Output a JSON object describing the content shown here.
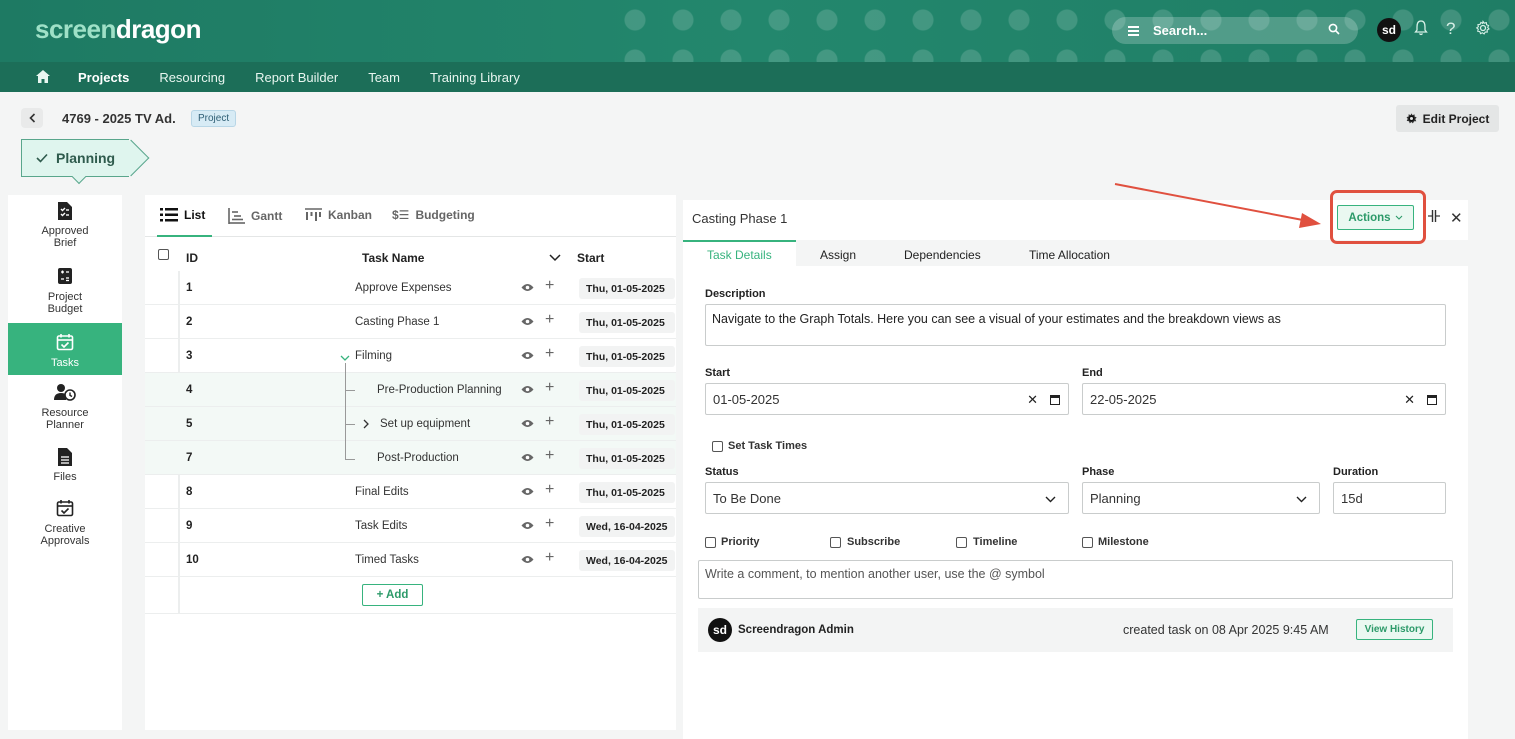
{
  "app": {
    "logo_part1": "screen",
    "logo_part2": "dragon",
    "search_placeholder": "Search...",
    "avatar_initials": "sd"
  },
  "nav": {
    "items": [
      {
        "label": "Projects",
        "active": true
      },
      {
        "label": "Resourcing"
      },
      {
        "label": "Report Builder"
      },
      {
        "label": "Team"
      },
      {
        "label": "Training Library"
      }
    ]
  },
  "project": {
    "title": "4769 - 2025 TV Ad.",
    "badge": "Project",
    "edit_label": "Edit Project",
    "stage": "Planning"
  },
  "sidebar": {
    "items": [
      {
        "label_line1": "Approved",
        "label_line2": "Brief",
        "icon": "document-check-icon"
      },
      {
        "label_line1": "Project",
        "label_line2": "Budget",
        "icon": "calculator-icon"
      },
      {
        "label_line1": "Tasks",
        "label_line2": "",
        "icon": "calendar-check-icon",
        "active": true
      },
      {
        "label_line1": "Resource",
        "label_line2": "Planner",
        "icon": "user-clock-icon"
      },
      {
        "label_line1": "Files",
        "label_line2": "",
        "icon": "file-icon"
      },
      {
        "label_line1": "Creative",
        "label_line2": "Approvals",
        "icon": "calendar-check-icon"
      }
    ]
  },
  "views": {
    "tabs": [
      {
        "label": "List",
        "icon": "list-icon",
        "active": true
      },
      {
        "label": "Gantt",
        "icon": "gantt-icon"
      },
      {
        "label": "Kanban",
        "icon": "kanban-icon"
      },
      {
        "label": "Budgeting",
        "icon": "budget-icon"
      }
    ]
  },
  "tasklist": {
    "columns": {
      "id": "ID",
      "name": "Task Name",
      "start": "Start"
    },
    "rows": [
      {
        "id": "1",
        "name": "Approve Expenses",
        "start": "Thu, 01-05-2025"
      },
      {
        "id": "2",
        "name": "Casting Phase 1",
        "start": "Thu, 01-05-2025"
      },
      {
        "id": "3",
        "name": "Filming",
        "start": "Thu, 01-05-2025"
      },
      {
        "id": "4",
        "name": "Pre-Production Planning",
        "start": "Thu, 01-05-2025"
      },
      {
        "id": "5",
        "name": "Set up equipment",
        "start": "Thu, 01-05-2025"
      },
      {
        "id": "7",
        "name": "Post-Production",
        "start": "Thu, 01-05-2025"
      },
      {
        "id": "8",
        "name": "Final Edits",
        "start": "Thu, 01-05-2025"
      },
      {
        "id": "9",
        "name": "Task Edits",
        "start": "Wed, 16-04-2025"
      },
      {
        "id": "10",
        "name": "Timed Tasks",
        "start": "Wed, 16-04-2025"
      }
    ],
    "add_label": "+ Add"
  },
  "detail": {
    "title": "Casting Phase 1",
    "actions_label": "Actions",
    "tabs": [
      {
        "label": "Task Details",
        "active": true
      },
      {
        "label": "Assign"
      },
      {
        "label": "Dependencies"
      },
      {
        "label": "Time Allocation"
      }
    ],
    "description_label": "Description",
    "description_value": "Navigate to the Graph Totals. Here you can see a visual of your estimates and the breakdown views as",
    "start_label": "Start",
    "start_value": "01-05-2025",
    "end_label": "End",
    "end_value": "22-05-2025",
    "set_task_times_label": "Set Task Times",
    "status_label": "Status",
    "status_value": "To Be Done",
    "phase_label": "Phase",
    "phase_value": "Planning",
    "duration_label": "Duration",
    "duration_value": "15d",
    "checkboxes": [
      {
        "label": "Priority"
      },
      {
        "label": "Subscribe"
      },
      {
        "label": "Timeline"
      },
      {
        "label": "Milestone"
      }
    ],
    "comment_placeholder": "Write a comment, to mention another user, use the @ symbol",
    "history": {
      "avatar_initials": "sd",
      "user": "Screendragon Admin",
      "action": "created task on  08 Apr 2025 9:45 AM",
      "button": "View History"
    }
  },
  "colors": {
    "header": "#1e7a63",
    "navbar": "#1c6e58",
    "accent": "#37b37e",
    "highlight": "#e0503f"
  }
}
